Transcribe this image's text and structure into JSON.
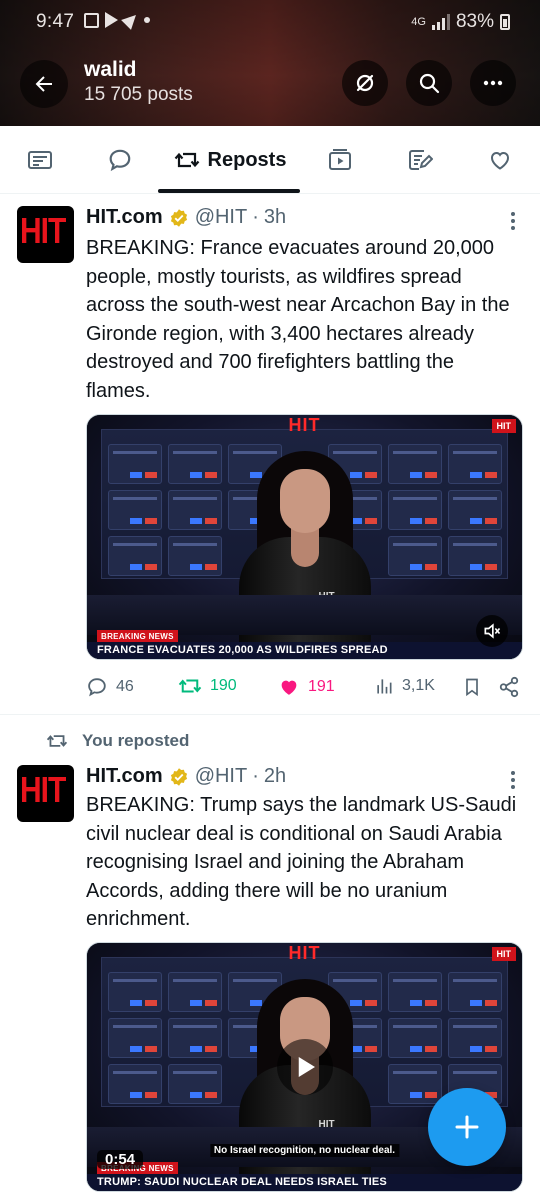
{
  "status_bar": {
    "time": "9:47",
    "network": "4G",
    "battery": "83%"
  },
  "profile": {
    "name": "walid",
    "posts_count": "15 705 posts"
  },
  "tabs": {
    "active_label": "Reposts",
    "items": [
      "articles-icon",
      "replies-icon",
      "reposts-icon",
      "videos-icon",
      "highlights-icon",
      "likes-icon"
    ]
  },
  "posts": [
    {
      "avatar_text": "HIT",
      "author": "HIT.com",
      "handle": "@HIT",
      "time": "3h",
      "text": "BREAKING: France evacuates around 20,000 people, mostly tourists, as wildfires spread across the south-west near Arcachon Bay in the Gironde region, with 3,400 hectares already destroyed and 700 firefighters battling the flames.",
      "media": {
        "logo": "HIT",
        "badge": "HIT",
        "anchor_logo": "HIT",
        "breaking_tag": "BREAKING NEWS",
        "ticker": "FRANCE EVACUATES 20,000 AS WILDFIRES SPREAD"
      },
      "replies": "46",
      "reposts": "190",
      "likes": "191",
      "views": "3,1K"
    },
    {
      "repost_label": "You reposted",
      "avatar_text": "HIT",
      "author": "HIT.com",
      "handle": "@HIT",
      "time": "2h",
      "text": "BREAKING: Trump says the landmark US-Saudi civil nuclear deal is conditional on Saudi Arabia recognising Israel and joining the Abraham Accords, adding there will be no uranium enrichment.",
      "media": {
        "logo": "HIT",
        "badge": "HIT",
        "anchor_logo": "HIT",
        "breaking_tag": "BREAKING NEWS",
        "ticker": "TRUMP: SAUDI NUCLEAR DEAL NEEDS ISRAEL TIES",
        "subtitle": "No Israel recognition, no nuclear deal.",
        "duration": "0:54"
      }
    }
  ],
  "colors": {
    "accent": "#1d9bf0",
    "repost_green": "#00ba7c",
    "like_pink": "#f91880",
    "verified_gold": "#e2b719",
    "muted": "#536471"
  }
}
